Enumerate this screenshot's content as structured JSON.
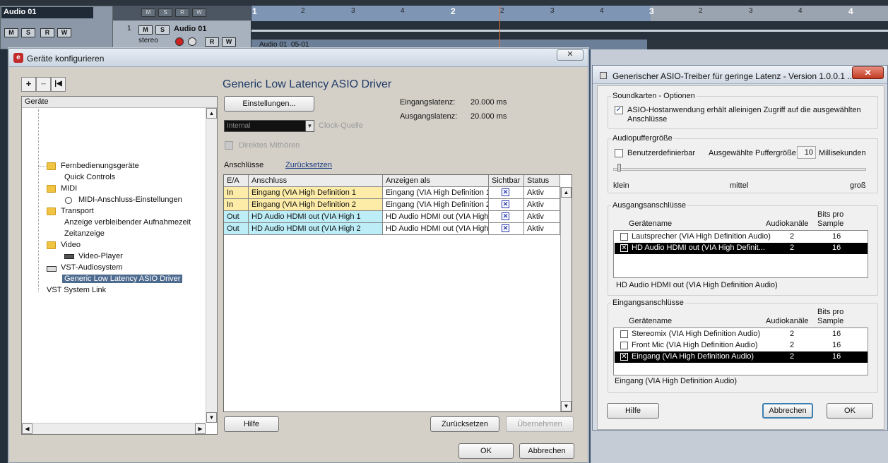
{
  "daw": {
    "track_name": "Audio 01",
    "track_row_number": "1",
    "track_row_name": "Audio 01",
    "track_row_mode": "stereo",
    "btn_m": "M",
    "btn_s": "S",
    "btn_r": "R",
    "btn_w": "W",
    "toolbar_buttons": [
      "M",
      "S",
      "R",
      "W"
    ],
    "clip_label": "Audio 01_05-01",
    "ruler": {
      "bars": [
        "1",
        "2",
        "3",
        "4"
      ],
      "beats": [
        "2",
        "3",
        "4",
        "2",
        "3",
        "4",
        "2",
        "3",
        "4"
      ]
    }
  },
  "dialog1": {
    "title": "Geräte konfigurieren",
    "close_label": "✕",
    "toolbar": {
      "add": "+",
      "remove": "−",
      "reset": "|◀"
    },
    "tree": {
      "header": "Geräte",
      "items": [
        {
          "label": "Fernbedienungsgeräte"
        },
        {
          "label": "Quick Controls"
        },
        {
          "label": "MIDI"
        },
        {
          "label": "MIDI-Anschluss-Einstellungen"
        },
        {
          "label": "Transport"
        },
        {
          "label": "Anzeige verbleibender Aufnahmezeit"
        },
        {
          "label": "Zeitanzeige"
        },
        {
          "label": "Video"
        },
        {
          "label": "Video-Player"
        },
        {
          "label": "VST-Audiosystem"
        },
        {
          "label": "Generic Low Latency ASIO Driver"
        },
        {
          "label": "VST System Link"
        }
      ]
    },
    "driver_title": "Generic Low Latency ASIO Driver",
    "settings_button": "Einstellungen...",
    "input_latency_label": "Eingangslatenz:",
    "input_latency_value": "20.000 ms",
    "output_latency_label": "Ausgangslatenz:",
    "output_latency_value": "20.000 ms",
    "clock_select_value": "Internal",
    "clock_label": "Clock-Quelle",
    "direct_monitoring_label": "Direktes Mithören",
    "ports_label": "Anschlüsse",
    "reset_link": "Zurücksetzen",
    "columns": [
      "E/A",
      "Anschluss",
      "Anzeigen als",
      "Sichtbar",
      "Status"
    ],
    "rows": [
      {
        "io": "In",
        "port": "Eingang (VIA High Definition 1",
        "display": "Eingang (VIA High Definition 1",
        "visible": true,
        "status": "Aktiv"
      },
      {
        "io": "In",
        "port": "Eingang (VIA High Definition 2",
        "display": "Eingang (VIA High Definition 2",
        "visible": true,
        "status": "Aktiv"
      },
      {
        "io": "Out",
        "port": "HD Audio HDMI out (VIA High  1",
        "display": "HD Audio HDMI out (VIA High",
        "visible": true,
        "status": "Aktiv"
      },
      {
        "io": "Out",
        "port": "HD Audio HDMI out (VIA High  2",
        "display": "HD Audio HDMI out (VIA High",
        "visible": true,
        "status": "Aktiv"
      }
    ],
    "help_button": "Hilfe",
    "reset_button": "Zurücksetzen",
    "apply_button": "Übernehmen",
    "ok_button": "OK",
    "cancel_button": "Abbrechen"
  },
  "dialog2": {
    "title": "Generischer ASIO-Treiber für geringe Latenz - Version 1.0.0.1 ...",
    "close_label": "✕",
    "soundcard_group": "Soundkarten - Optionen",
    "exclusive_label_1": "ASIO-Hostanwendung erhält alleinigen Zugriff auf die ausgewählten",
    "exclusive_label_2": "Anschlüsse",
    "exclusive_checked": true,
    "buffer_group": "Audiopuffergröße",
    "custom_label": "Benutzerdefinierbar",
    "selected_buffer_label": "Ausgewählte Puffergröße:",
    "buffer_value": "10",
    "buffer_unit": "Millisekunden",
    "slider_min": "klein",
    "slider_mid": "mittel",
    "slider_max": "groß",
    "output_group": "Ausgangsanschlüsse",
    "input_group": "Eingangsanschlüsse",
    "col_device": "Gerätename",
    "col_channels": "Audiokanäle",
    "col_bits_1": "Bits pro",
    "col_bits_2": "Sample",
    "outputs": [
      {
        "name": "Lautsprecher (VIA High Definition Audio)",
        "channels": "2",
        "bits": "16",
        "checked": false
      },
      {
        "name": "HD Audio HDMI out (VIA High Definit...",
        "channels": "2",
        "bits": "16",
        "checked": true
      }
    ],
    "output_selected_text": "HD Audio HDMI out (VIA High Definition Audio)",
    "inputs": [
      {
        "name": "Stereomix (VIA High Definition Audio)",
        "channels": "2",
        "bits": "16",
        "checked": false
      },
      {
        "name": "Front Mic (VIA High Definition Audio)",
        "channels": "2",
        "bits": "16",
        "checked": false
      },
      {
        "name": "Eingang (VIA High Definition Audio)",
        "channels": "2",
        "bits": "16",
        "checked": true
      }
    ],
    "input_selected_text": "Eingang (VIA High Definition Audio)",
    "help_button": "Hilfe",
    "cancel_button": "Abbrechen",
    "ok_button": "OK"
  }
}
